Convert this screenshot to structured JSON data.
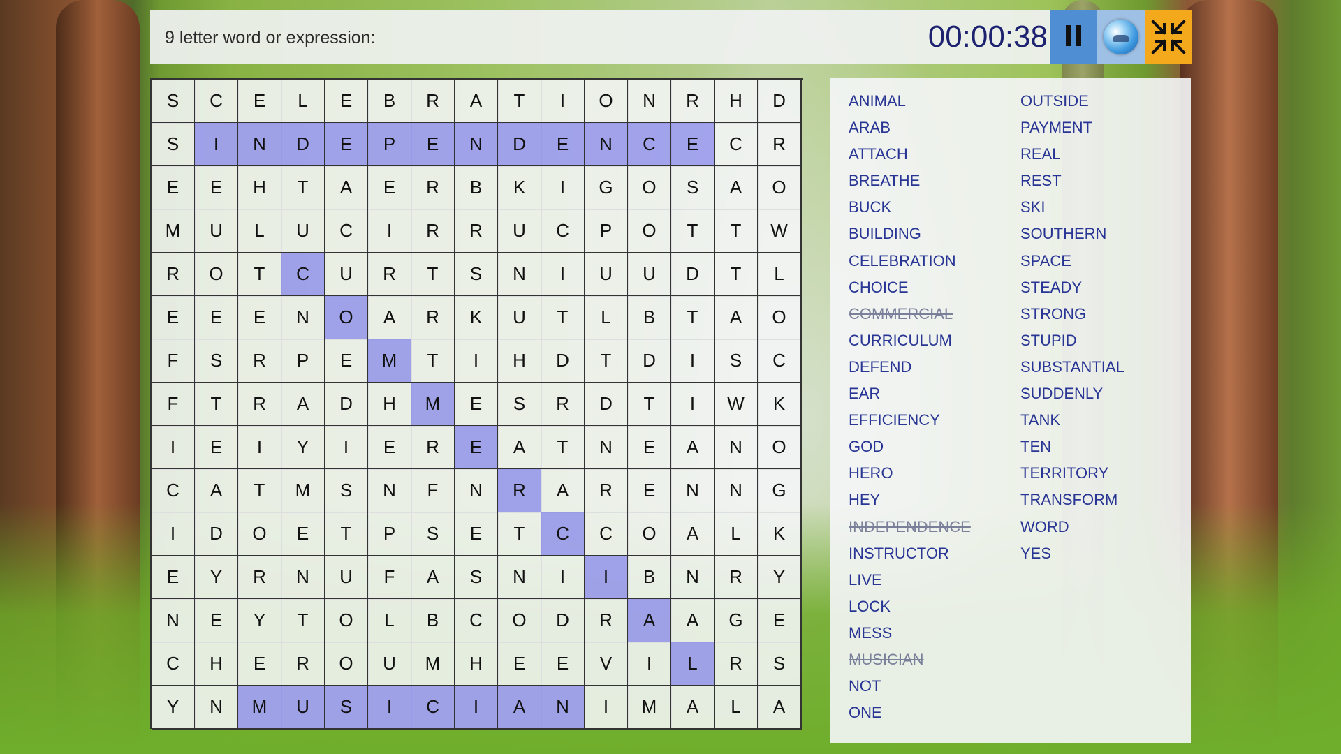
{
  "prompt": "9 letter word or expression:",
  "timer": "00:00:38",
  "buttons": {
    "pause": "pause-icon",
    "hint": "genie-lamp-icon",
    "shrink": "shrink-icon"
  },
  "colors": {
    "highlight": "#a0a0f0",
    "word": "#283594",
    "pause_bg": "#4f8ed3",
    "shrink_bg": "#f4a81c",
    "timer": "#1c2170"
  },
  "grid": [
    "SCELEBRATIONRHD",
    "SINDEPENDENCECR",
    "EEHTAERBKIGOSAO",
    "MULUCIRRUCPOTTW",
    "ROTCURTSNIUUDTL",
    "EEENOARKUTLBTAO",
    "FSRPEMTIHDTDISC",
    "FTRADHMESRDTIWK",
    "IEIYIEREATNEANO",
    "CATMSNFNRARENNG",
    "IDOETPSETCCOALK",
    "EYRNUFASNIIBNRY",
    "NEYTOLBCODRAAGE",
    "CHEROUMHEEVILRS",
    "YNMUSICIANIMALA"
  ],
  "highlighted": [
    [
      1,
      1
    ],
    [
      1,
      2
    ],
    [
      1,
      3
    ],
    [
      1,
      4
    ],
    [
      1,
      5
    ],
    [
      1,
      6
    ],
    [
      1,
      7
    ],
    [
      1,
      8
    ],
    [
      1,
      9
    ],
    [
      1,
      10
    ],
    [
      1,
      11
    ],
    [
      1,
      12
    ],
    [
      4,
      3
    ],
    [
      5,
      4
    ],
    [
      6,
      5
    ],
    [
      7,
      6
    ],
    [
      8,
      7
    ],
    [
      9,
      8
    ],
    [
      10,
      9
    ],
    [
      11,
      10
    ],
    [
      12,
      11
    ],
    [
      13,
      12
    ],
    [
      14,
      2
    ],
    [
      14,
      3
    ],
    [
      14,
      4
    ],
    [
      14,
      5
    ],
    [
      14,
      6
    ],
    [
      14,
      7
    ],
    [
      14,
      8
    ],
    [
      14,
      9
    ]
  ],
  "words_col1": [
    {
      "text": "ANIMAL",
      "found": false
    },
    {
      "text": "ARAB",
      "found": false
    },
    {
      "text": "ATTACH",
      "found": false
    },
    {
      "text": "BREATHE",
      "found": false
    },
    {
      "text": "BUCK",
      "found": false
    },
    {
      "text": "BUILDING",
      "found": false
    },
    {
      "text": "CELEBRATION",
      "found": false
    },
    {
      "text": "CHOICE",
      "found": false
    },
    {
      "text": "COMMERCIAL",
      "found": true
    },
    {
      "text": "CURRICULUM",
      "found": false
    },
    {
      "text": "DEFEND",
      "found": false
    },
    {
      "text": "EAR",
      "found": false
    },
    {
      "text": "EFFICIENCY",
      "found": false
    },
    {
      "text": "GOD",
      "found": false
    },
    {
      "text": "HERO",
      "found": false
    },
    {
      "text": "HEY",
      "found": false
    },
    {
      "text": "INDEPENDENCE",
      "found": true
    },
    {
      "text": "INSTRUCTOR",
      "found": false
    },
    {
      "text": "LIVE",
      "found": false
    },
    {
      "text": "LOCK",
      "found": false
    },
    {
      "text": "MESS",
      "found": false
    },
    {
      "text": "MUSICIAN",
      "found": true
    },
    {
      "text": "NOT",
      "found": false
    },
    {
      "text": "ONE",
      "found": false
    }
  ],
  "words_col2": [
    {
      "text": "OUTSIDE",
      "found": false
    },
    {
      "text": "PAYMENT",
      "found": false
    },
    {
      "text": "REAL",
      "found": false
    },
    {
      "text": "REST",
      "found": false
    },
    {
      "text": "SKI",
      "found": false
    },
    {
      "text": "SOUTHERN",
      "found": false
    },
    {
      "text": "SPACE",
      "found": false
    },
    {
      "text": "STEADY",
      "found": false
    },
    {
      "text": "STRONG",
      "found": false
    },
    {
      "text": "STUPID",
      "found": false
    },
    {
      "text": "SUBSTANTIAL",
      "found": false
    },
    {
      "text": "SUDDENLY",
      "found": false
    },
    {
      "text": "TANK",
      "found": false
    },
    {
      "text": "TEN",
      "found": false
    },
    {
      "text": "TERRITORY",
      "found": false
    },
    {
      "text": "TRANSFORM",
      "found": false
    },
    {
      "text": "WORD",
      "found": false
    },
    {
      "text": "YES",
      "found": false
    }
  ]
}
